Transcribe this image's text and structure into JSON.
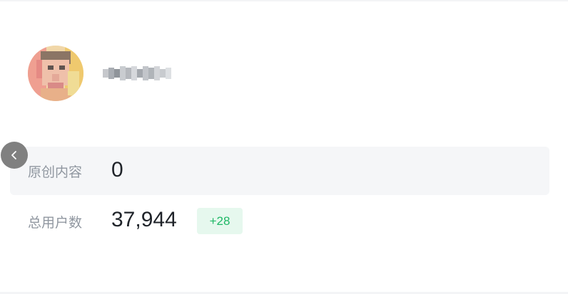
{
  "profile": {
    "avatar_icon": "blurred-avatar",
    "username_icon": "blurred-username"
  },
  "collapse_button": {
    "icon": "chevron-left-icon"
  },
  "stats": {
    "original_content": {
      "label": "原创内容",
      "value": "0"
    },
    "total_users": {
      "label": "总用户数",
      "value": "37,944",
      "delta": "+28"
    }
  },
  "colors": {
    "highlight_bg": "#f5f6f8",
    "label": "#9097a0",
    "value": "#1f2329",
    "delta_bg": "#e6f8ee",
    "delta_text": "#1fb866",
    "collapse_bg": "#808080"
  }
}
